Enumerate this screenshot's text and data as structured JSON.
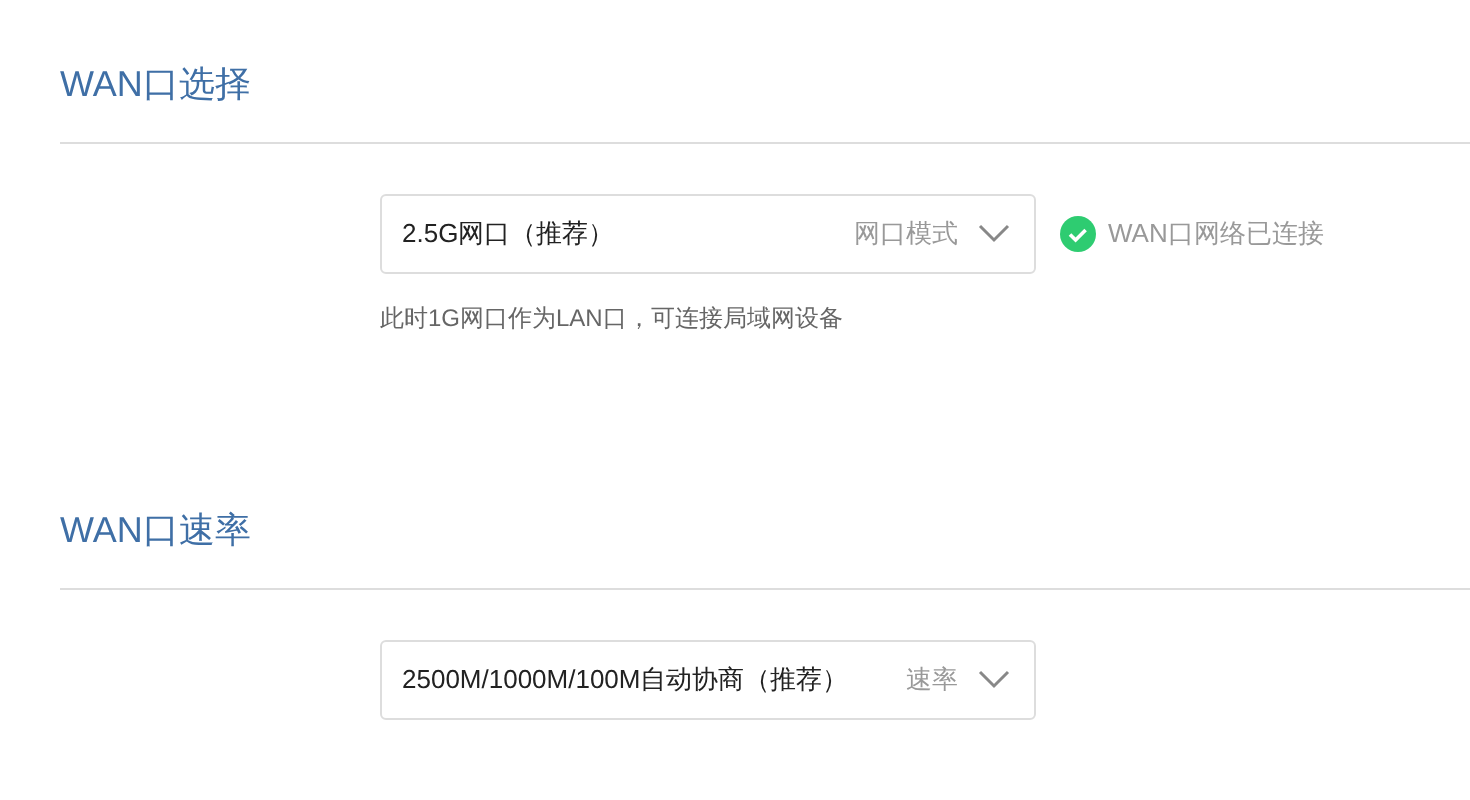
{
  "sections": [
    {
      "title": "WAN口选择",
      "select": {
        "value": "2.5G网口（推荐）",
        "tag": "网口模式"
      },
      "status": {
        "connected": true,
        "text": "WAN口网络已连接"
      },
      "hint": "此时1G网口作为LAN口，可连接局域网设备"
    },
    {
      "title": "WAN口速率",
      "select": {
        "value": "2500M/1000M/100M自动协商（推荐）",
        "tag": "速率"
      }
    }
  ]
}
